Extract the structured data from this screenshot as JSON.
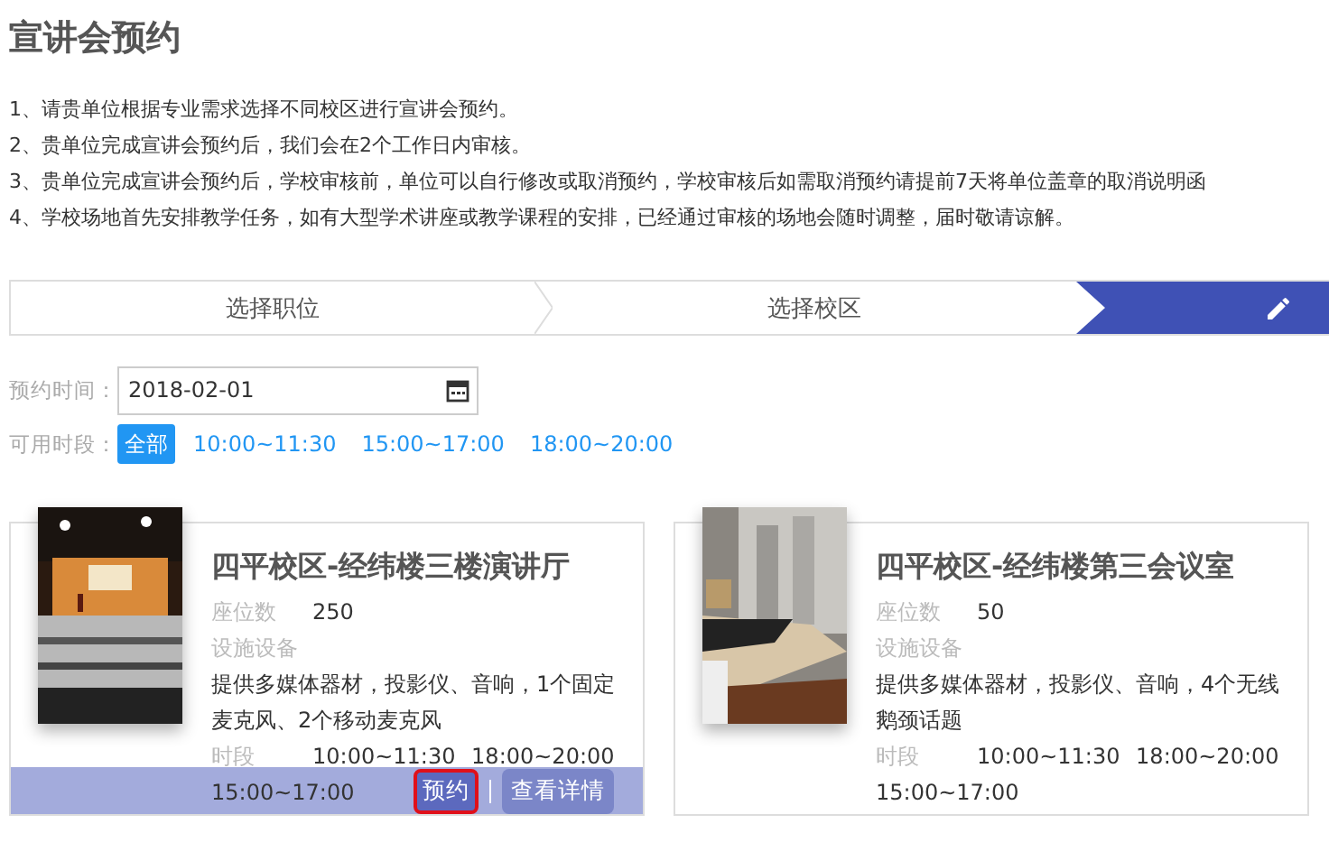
{
  "title": "宣讲会预约",
  "notes": [
    "1、请贵单位根据专业需求选择不同校区进行宣讲会预约。",
    "2、贵单位完成宣讲会预约后，我们会在2个工作日内审核。",
    "3、贵单位完成宣讲会预约后，学校审核前，单位可以自行修改或取消预约，学校审核后如需取消预约请提前7天将单位盖章的取消说明函",
    "4、学校场地首先安排教学任务，如有大型学术讲座或教学课程的安排，已经通过审核的场地会随时调整，届时敬请谅解。"
  ],
  "steps": [
    {
      "label": "选择职位",
      "selected": false
    },
    {
      "label": "选择校区",
      "selected": false
    },
    {
      "kind": "edit",
      "selected": true
    }
  ],
  "date_field": {
    "label": "预约时间：",
    "value": "2018-02-01"
  },
  "periods": {
    "label": "可用时段：",
    "options": [
      {
        "label": "全部",
        "selected": true
      },
      {
        "label": "10:00~11:30",
        "selected": false
      },
      {
        "label": "15:00~17:00",
        "selected": false
      },
      {
        "label": "18:00~20:00",
        "selected": false
      }
    ]
  },
  "rooms": [
    {
      "name": "四平校区-经纬楼三楼演讲厅",
      "seats_label": "座位数",
      "seats": "250",
      "equipment_label": "设施设备",
      "equipment": "提供多媒体器材，投影仪、音响，1个固定麦克风、2个移动麦克风",
      "time_label": "时段",
      "times": [
        "10:00~11:30",
        "18:00~20:00",
        "15:00~17:00"
      ],
      "hovered": true,
      "actions": [
        {
          "label": "预约",
          "highlighted": true
        },
        {
          "label": "查看详情",
          "highlighted": false
        }
      ]
    },
    {
      "name": "四平校区-经纬楼第三会议室",
      "seats_label": "座位数",
      "seats": "50",
      "equipment_label": "设施设备",
      "equipment": "提供多媒体器材，投影仪、音响，4个无线鹅颈话题",
      "time_label": "时段",
      "times": [
        "10:00~11:30",
        "18:00~20:00",
        "15:00~17:00"
      ],
      "hovered": false
    }
  ]
}
